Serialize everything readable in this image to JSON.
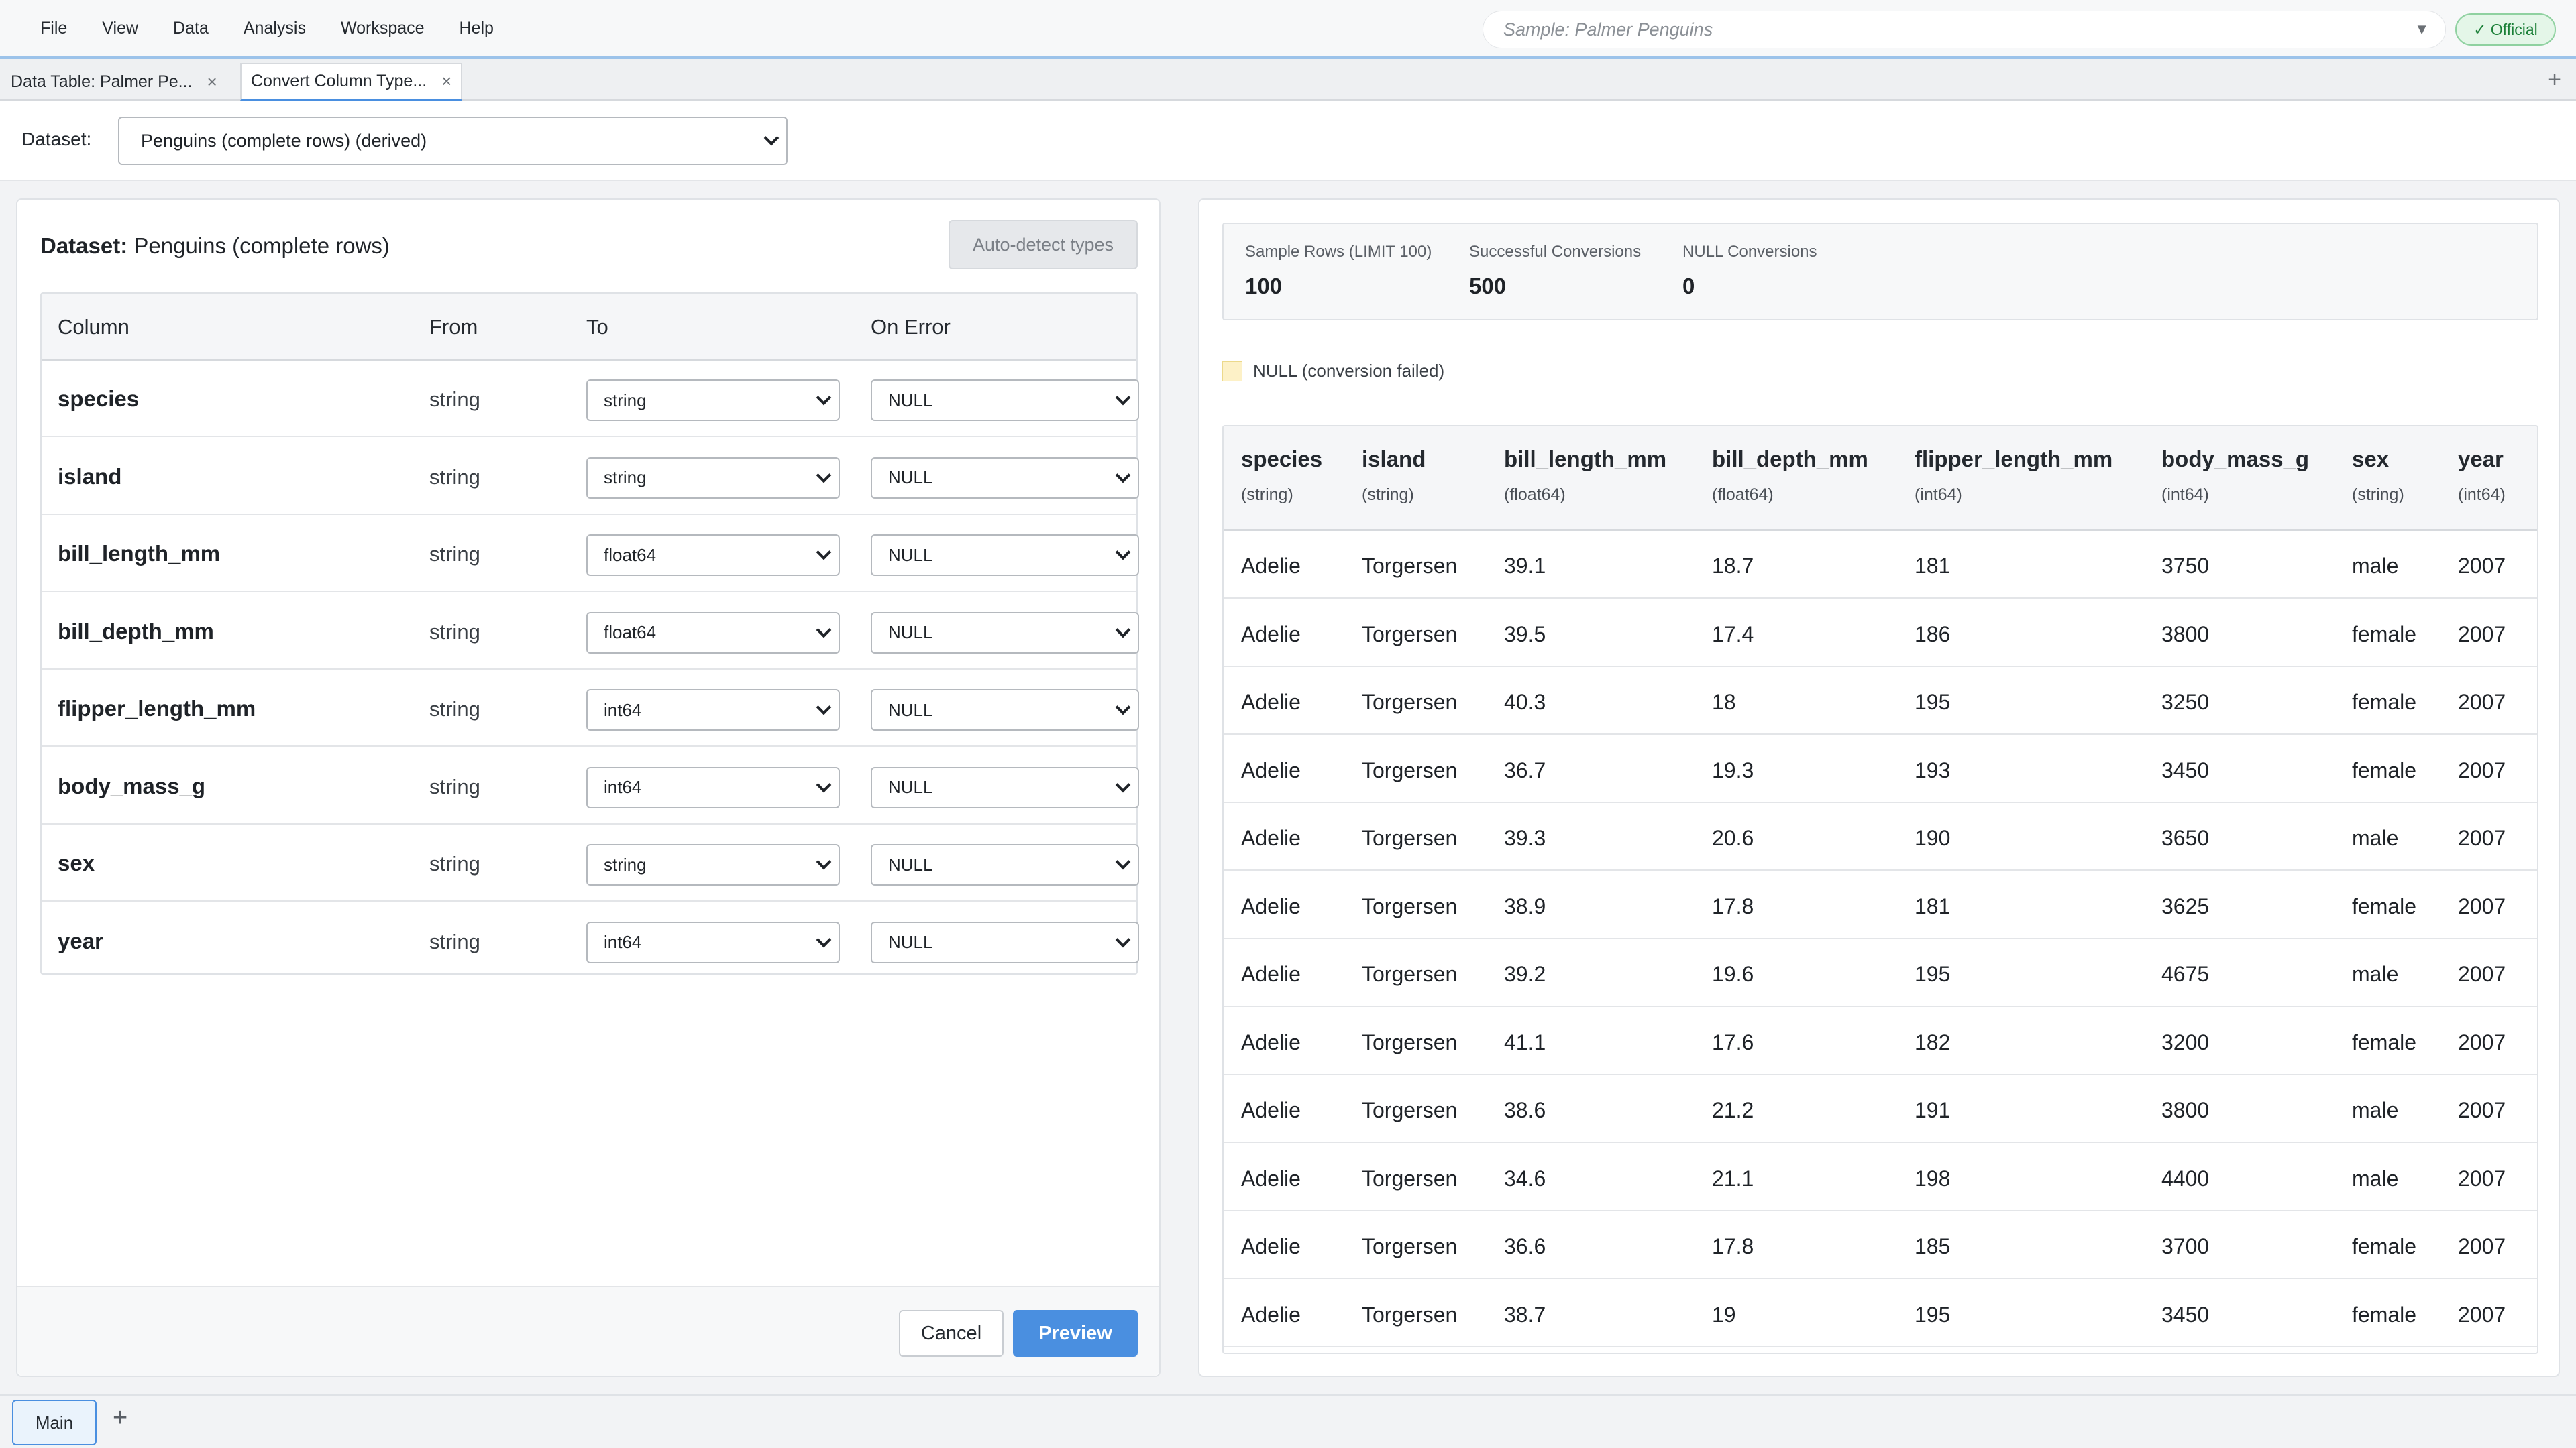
{
  "menu": [
    "File",
    "View",
    "Data",
    "Analysis",
    "Workspace",
    "Help"
  ],
  "sample_placeholder": "Sample: Palmer Penguins",
  "official_badge": "✓ Official",
  "doc_tabs": [
    {
      "label": "Data Table: Palmer Pe...",
      "active": false
    },
    {
      "label": "Convert Column Type...",
      "active": true
    }
  ],
  "dataset_bar": {
    "label": "Dataset:",
    "value": "Penguins (complete rows) (derived)"
  },
  "left": {
    "title_prefix": "Dataset:",
    "title_value": "Penguins (complete rows)",
    "autodetect_label": "Auto-detect types",
    "headers": {
      "column": "Column",
      "from": "From",
      "to": "To",
      "on_error": "On Error"
    },
    "rows": [
      {
        "column": "species",
        "from": "string",
        "to": "string",
        "on_error": "NULL"
      },
      {
        "column": "island",
        "from": "string",
        "to": "string",
        "on_error": "NULL"
      },
      {
        "column": "bill_length_mm",
        "from": "string",
        "to": "float64",
        "on_error": "NULL"
      },
      {
        "column": "bill_depth_mm",
        "from": "string",
        "to": "float64",
        "on_error": "NULL"
      },
      {
        "column": "flipper_length_mm",
        "from": "string",
        "to": "int64",
        "on_error": "NULL"
      },
      {
        "column": "body_mass_g",
        "from": "string",
        "to": "int64",
        "on_error": "NULL"
      },
      {
        "column": "sex",
        "from": "string",
        "to": "string",
        "on_error": "NULL"
      },
      {
        "column": "year",
        "from": "string",
        "to": "int64",
        "on_error": "NULL"
      }
    ],
    "cancel_label": "Cancel",
    "preview_label": "Preview"
  },
  "right": {
    "stats": [
      {
        "label": "Sample Rows (LIMIT 100)",
        "value": "100"
      },
      {
        "label": "Successful Conversions",
        "value": "500"
      },
      {
        "label": "NULL Conversions",
        "value": "0"
      }
    ],
    "legend": "NULL (conversion failed)",
    "columns": [
      {
        "name": "species",
        "type": "(string)"
      },
      {
        "name": "island",
        "type": "(string)"
      },
      {
        "name": "bill_length_mm",
        "type": "(float64)"
      },
      {
        "name": "bill_depth_mm",
        "type": "(float64)"
      },
      {
        "name": "flipper_length_mm",
        "type": "(int64)"
      },
      {
        "name": "body_mass_g",
        "type": "(int64)"
      },
      {
        "name": "sex",
        "type": "(string)"
      },
      {
        "name": "year",
        "type": "(int64)"
      }
    ],
    "rows": [
      [
        "Adelie",
        "Torgersen",
        "39.1",
        "18.7",
        "181",
        "3750",
        "male",
        "2007"
      ],
      [
        "Adelie",
        "Torgersen",
        "39.5",
        "17.4",
        "186",
        "3800",
        "female",
        "2007"
      ],
      [
        "Adelie",
        "Torgersen",
        "40.3",
        "18",
        "195",
        "3250",
        "female",
        "2007"
      ],
      [
        "Adelie",
        "Torgersen",
        "36.7",
        "19.3",
        "193",
        "3450",
        "female",
        "2007"
      ],
      [
        "Adelie",
        "Torgersen",
        "39.3",
        "20.6",
        "190",
        "3650",
        "male",
        "2007"
      ],
      [
        "Adelie",
        "Torgersen",
        "38.9",
        "17.8",
        "181",
        "3625",
        "female",
        "2007"
      ],
      [
        "Adelie",
        "Torgersen",
        "39.2",
        "19.6",
        "195",
        "4675",
        "male",
        "2007"
      ],
      [
        "Adelie",
        "Torgersen",
        "41.1",
        "17.6",
        "182",
        "3200",
        "female",
        "2007"
      ],
      [
        "Adelie",
        "Torgersen",
        "38.6",
        "21.2",
        "191",
        "3800",
        "male",
        "2007"
      ],
      [
        "Adelie",
        "Torgersen",
        "34.6",
        "21.1",
        "198",
        "4400",
        "male",
        "2007"
      ],
      [
        "Adelie",
        "Torgersen",
        "36.6",
        "17.8",
        "185",
        "3700",
        "female",
        "2007"
      ],
      [
        "Adelie",
        "Torgersen",
        "38.7",
        "19",
        "195",
        "3450",
        "female",
        "2007"
      ]
    ]
  },
  "workspace_tabs": [
    {
      "label": "Main",
      "active": true
    }
  ],
  "colors": {
    "accent": "#4a8fe0",
    "official_green": "#1a7f37",
    "null_highlight": "#fdf1c7"
  }
}
